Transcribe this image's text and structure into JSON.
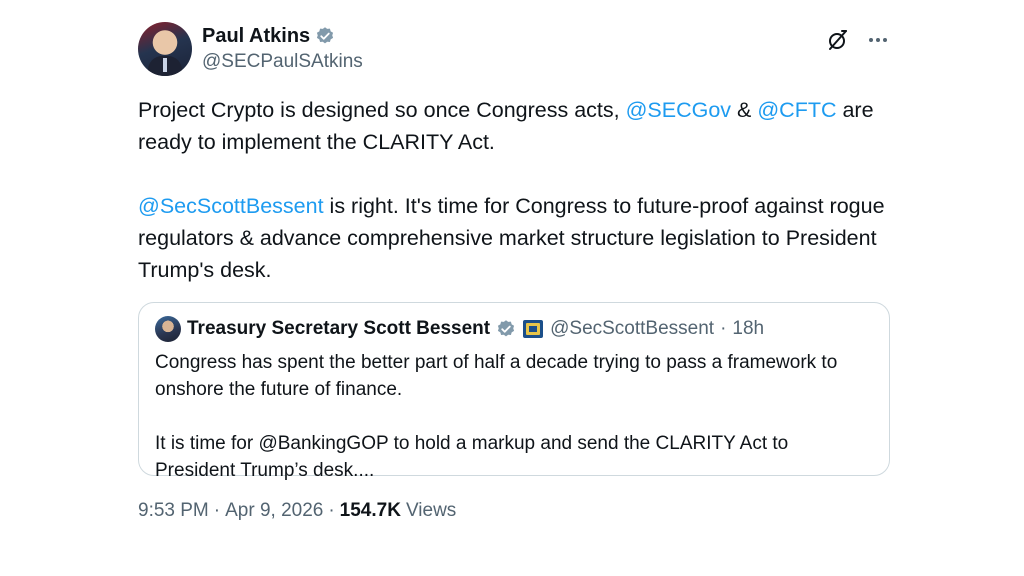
{
  "author": {
    "name": "Paul Atkins",
    "handle": "@SECPaulSAtkins",
    "verified_color": "#829aab"
  },
  "tweet": {
    "p1": {
      "t1": "Project Crypto is designed so once Congress acts, ",
      "m1": "@SECGov",
      "t2": " & ",
      "m2": "@CFTC",
      "t3": " are ready to implement the CLARITY Act."
    },
    "p2": {
      "m1": "@SecScottBessent",
      "t1": " is right. It's time for Congress to future-proof against rogue regulators & advance comprehensive market structure legislation to President Trump's desk."
    }
  },
  "quote": {
    "name": "Treasury Secretary Scott Bessent",
    "handle": "@SecScottBessent",
    "separator": "·",
    "time": "18h",
    "p1": "Congress has spent the better part of half a decade trying to pass a framework to onshore the future of finance.",
    "p2": "It is time for @BankingGOP to hold a markup and send the CLARITY Act to President Trump’s desk...."
  },
  "meta": {
    "time": "9:53 PM",
    "sep1": "·",
    "date": "Apr 9, 2026",
    "sep2": "·",
    "views_count": "154.7K",
    "views_label": "Views"
  },
  "icons": {
    "grok": "grok-icon",
    "more": "more-icon",
    "verified": "verified-badge-icon",
    "gov_badge": "government-affiliation-icon"
  },
  "colors": {
    "mention": "#1d9bf0",
    "secondary_text": "#536471",
    "border": "#cfd9de"
  }
}
